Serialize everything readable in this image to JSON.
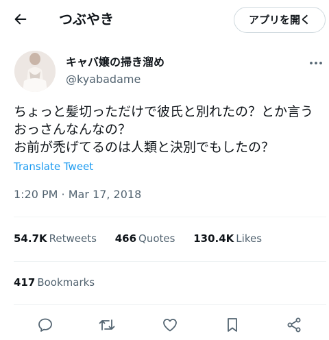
{
  "header": {
    "back_icon": "arrow-left-icon",
    "title": "つぶやき",
    "open_app_label": "アプリを開く"
  },
  "author": {
    "display_name": "キャバ嬢の掃き溜め",
    "handle": "@kyabadame",
    "more_icon": "more-horizontal-icon"
  },
  "tweet": {
    "lines": [
      "ちょっと髪切っただけで彼氏と別れたの？とか言う",
      "おっさんなんなの？",
      "お前が禿げてるのは人類と決別でもしたの？"
    ],
    "translate_label": "Translate Tweet",
    "time": "1:20 PM",
    "separator": " · ",
    "date": "Mar 17, 2018"
  },
  "stats": {
    "retweets": {
      "value": "54.7K",
      "label": "Retweets"
    },
    "quotes": {
      "value": "466",
      "label": "Quotes"
    },
    "likes": {
      "value": "130.4K",
      "label": "Likes"
    },
    "bookmarks": {
      "value": "417",
      "label": "Bookmarks"
    }
  },
  "actions": {
    "reply_icon": "reply-icon",
    "retweet_icon": "retweet-icon",
    "like_icon": "heart-icon",
    "bookmark_icon": "bookmark-icon",
    "share_icon": "share-icon"
  },
  "colors": {
    "text": "#0f1419",
    "secondary": "#536471",
    "link": "#1d9bf0",
    "border": "#cfd9de",
    "divider": "#eff3f4"
  }
}
